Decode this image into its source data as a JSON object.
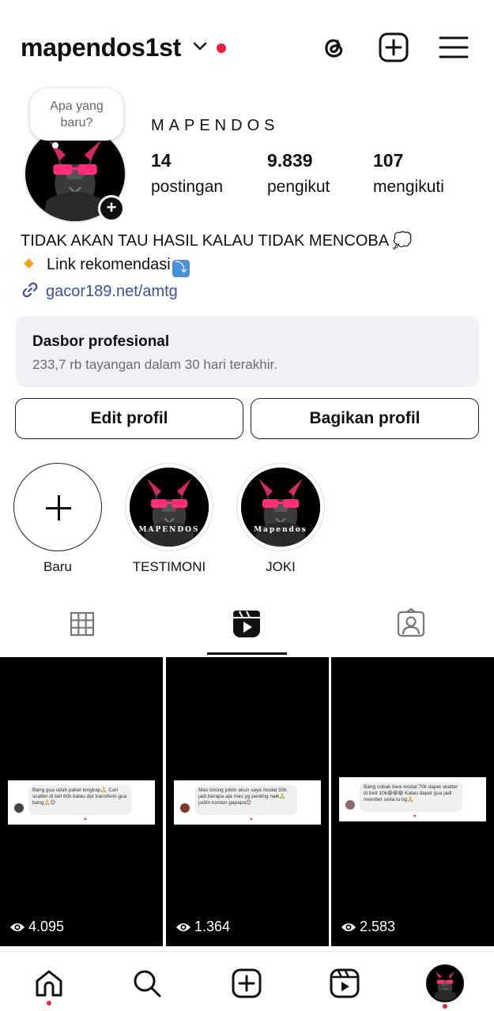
{
  "header": {
    "username": "mapendos1st",
    "icons": [
      "threads-icon",
      "create-post-icon",
      "menu-icon"
    ],
    "notification_color": "#ef1d3c"
  },
  "note_bubble": {
    "text_line1": "Apa yang",
    "text_line2": "baru?"
  },
  "profile": {
    "display_name": "MAPENDOS",
    "stats": [
      {
        "value": "14",
        "label": "postingan"
      },
      {
        "value": "9.839",
        "label": "pengikut"
      },
      {
        "value": "107",
        "label": "mengikuti"
      }
    ],
    "bio_line1": "TIDAK AKAN TAU HASIL KALAU TIDAK MENCOBA 💭",
    "bio_line2": "Link rekomendasi",
    "link": "gacor189.net/amtg"
  },
  "dashboard": {
    "title": "Dasbor profesional",
    "subtitle": "233,7 rb tayangan dalam 30 hari terakhir."
  },
  "buttons": {
    "edit": "Edit profil",
    "share": "Bagikan profil"
  },
  "highlights": [
    {
      "label": "Baru"
    },
    {
      "label": "TESTIMONI",
      "brand": "MAPENDOS"
    },
    {
      "label": "JOKI",
      "brand": "Mapendos"
    }
  ],
  "tabs": {
    "active": "reels",
    "items": [
      "grid-icon",
      "reels-icon",
      "tagged-icon"
    ]
  },
  "reels": [
    {
      "views": "4.095",
      "message": "Bang gua udah paket lengkap🙏 Cari scatter di bet 60k kalau dpt transferin gua bang🙏😊"
    },
    {
      "views": "1.364",
      "message": "Mas tolong jokiin akun saya modal 50k jadi berapa aja mas yg penting naik🙏 judiin konten gapapa😊"
    },
    {
      "views": "2.583",
      "message": "Bang cobak bwa modal 70k dapet skatter di bett 10k😁😁😁 Kalau dapet gua jadi member setia lu bg🙏"
    }
  ],
  "navbar": {
    "items": [
      "home-icon",
      "search-icon",
      "create-icon",
      "reels-nav-icon",
      "profile-avatar"
    ]
  }
}
